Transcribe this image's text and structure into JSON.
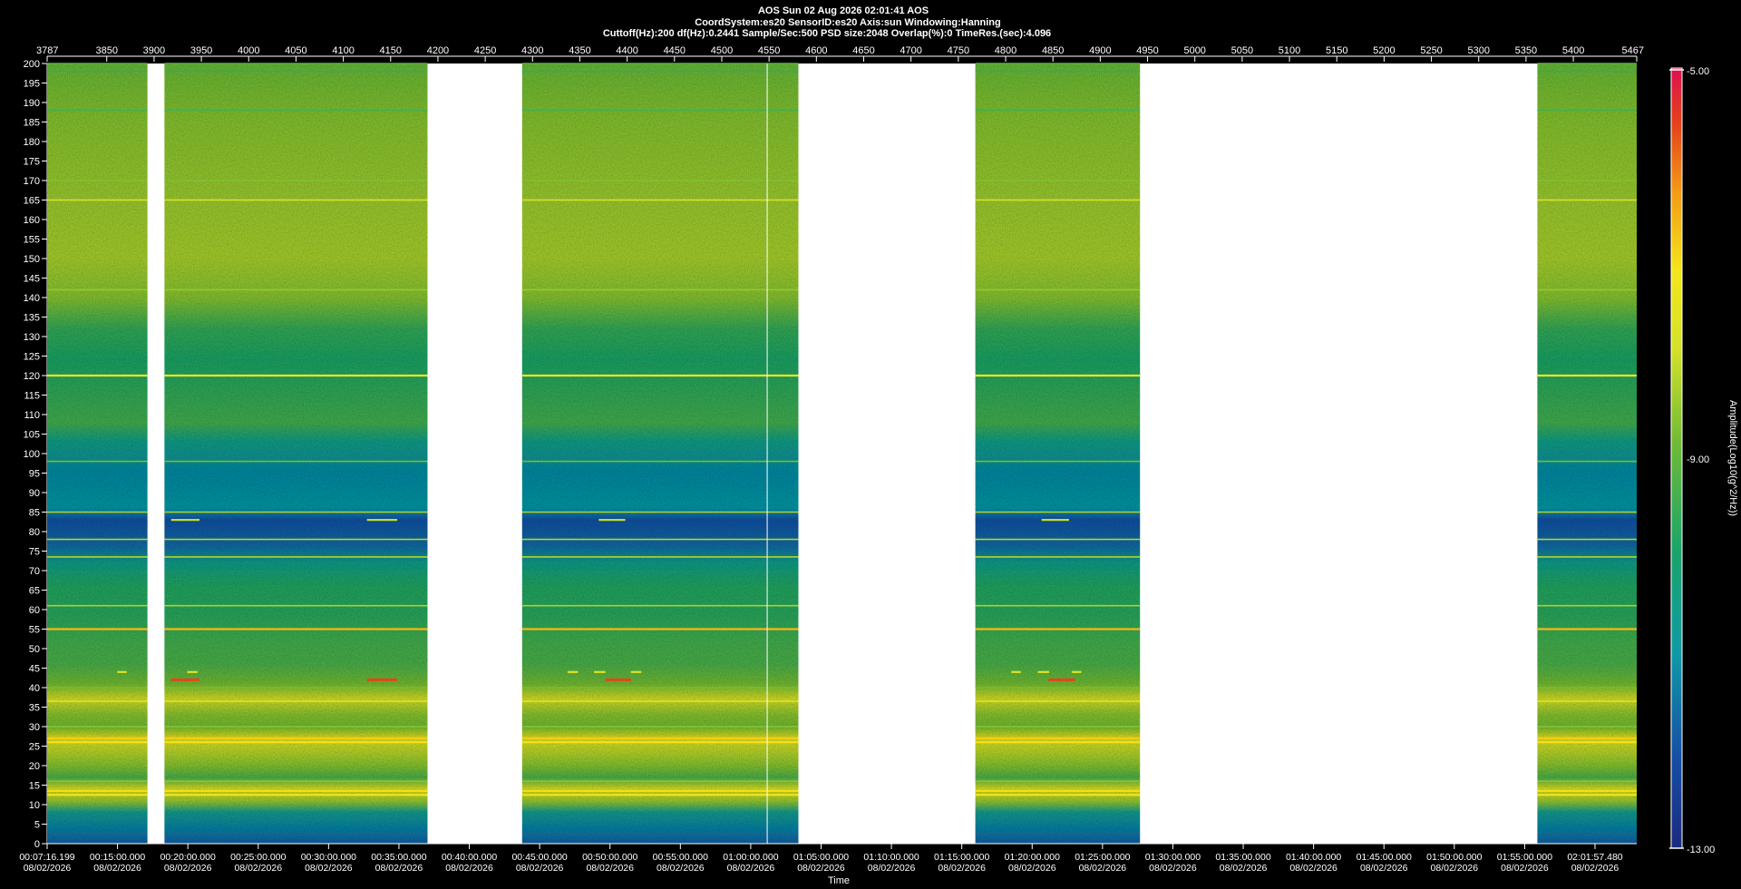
{
  "header": {
    "line1": "AOS  Sun 02 Aug 2026 02:01:41  AOS",
    "line2": "CoordSystem:es20    SensorID:es20    Axis:sun    Windowing:Hanning",
    "line3": "Cuttoff(Hz):200       df(Hz):0.2441       Sample/Sec:500       PSD size:2048       Overlap(%):0         TimeRes.(sec):4.096"
  },
  "chart_data": {
    "type": "heatmap",
    "title": "AOS  Sun 02 Aug 2026 02:01:41  AOS",
    "xlabel": "Time",
    "ylabel": "",
    "colorbar_label": "Amplitude(Log10(g^2/Hz))",
    "colorbar_ticks": [
      "-5.00",
      "-9.00",
      "-13.00"
    ],
    "colorbar_range": [
      -13,
      -5
    ],
    "ylim": [
      0,
      200
    ],
    "y_ticks": [
      0,
      5,
      10,
      15,
      20,
      25,
      30,
      35,
      40,
      45,
      50,
      55,
      60,
      65,
      70,
      75,
      80,
      85,
      90,
      95,
      100,
      105,
      110,
      115,
      120,
      125,
      130,
      135,
      140,
      145,
      150,
      155,
      160,
      165,
      170,
      175,
      180,
      185,
      190,
      195,
      200
    ],
    "top_axis_range": [
      3787,
      5467
    ],
    "top_ticks": [
      3787,
      3850,
      3900,
      3950,
      4000,
      4050,
      4100,
      4150,
      4200,
      4250,
      4300,
      4350,
      4400,
      4450,
      4500,
      4550,
      4600,
      4650,
      4700,
      4750,
      4800,
      4850,
      4900,
      4950,
      5000,
      5050,
      5100,
      5150,
      5200,
      5250,
      5300,
      5350,
      5400,
      5467
    ],
    "time_ticks": [
      {
        "time": "00:07:16.199",
        "date": "08/02/2026"
      },
      {
        "time": "00:15:00.000",
        "date": "08/02/2026"
      },
      {
        "time": "00:20:00.000",
        "date": "08/02/2026"
      },
      {
        "time": "00:25:00.000",
        "date": "08/02/2026"
      },
      {
        "time": "00:30:00.000",
        "date": "08/02/2026"
      },
      {
        "time": "00:35:00.000",
        "date": "08/02/2026"
      },
      {
        "time": "00:40:00.000",
        "date": "08/02/2026"
      },
      {
        "time": "00:45:00.000",
        "date": "08/02/2026"
      },
      {
        "time": "00:50:00.000",
        "date": "08/02/2026"
      },
      {
        "time": "00:55:00.000",
        "date": "08/02/2026"
      },
      {
        "time": "01:00:00.000",
        "date": "08/02/2026"
      },
      {
        "time": "01:05:00.000",
        "date": "08/02/2026"
      },
      {
        "time": "01:10:00.000",
        "date": "08/02/2026"
      },
      {
        "time": "01:15:00.000",
        "date": "08/02/2026"
      },
      {
        "time": "01:20:00.000",
        "date": "08/02/2026"
      },
      {
        "time": "01:25:00.000",
        "date": "08/02/2026"
      },
      {
        "time": "01:30:00.000",
        "date": "08/02/2026"
      },
      {
        "time": "01:35:00.000",
        "date": "08/02/2026"
      },
      {
        "time": "01:40:00.000",
        "date": "08/02/2026"
      },
      {
        "time": "01:45:00.000",
        "date": "08/02/2026"
      },
      {
        "time": "01:50:00.000",
        "date": "08/02/2026"
      },
      {
        "time": "01:55:00.000",
        "date": "08/02/2026"
      },
      {
        "time": "02:01:57.480",
        "date": "08/02/2026"
      }
    ],
    "data_segments": [
      {
        "start": 3787,
        "end": 3893
      },
      {
        "start": 3911,
        "end": 4189
      },
      {
        "start": 4289,
        "end": 4581
      },
      {
        "start": 4768,
        "end": 4942
      },
      {
        "start": 5362,
        "end": 5467
      }
    ],
    "tonal_lines": [
      {
        "hz": 200,
        "level": -9.2
      },
      {
        "hz": 198,
        "level": -9.6
      },
      {
        "hz": 188,
        "level": -9.4
      },
      {
        "hz": 170,
        "level": -8.7
      },
      {
        "hz": 165,
        "level": -7.6
      },
      {
        "hz": 142,
        "level": -8.5
      },
      {
        "hz": 120,
        "level": -7.2
      },
      {
        "hz": 98,
        "level": -8.8
      },
      {
        "hz": 85,
        "level": -8.2
      },
      {
        "hz": 78,
        "level": -8.2
      },
      {
        "hz": 73.5,
        "level": -8.2
      },
      {
        "hz": 61,
        "level": -8.3
      },
      {
        "hz": 55,
        "level": -6.6
      },
      {
        "hz": 40,
        "level": -8.8
      },
      {
        "hz": 36.5,
        "level": -7.6
      },
      {
        "hz": 30,
        "level": -8.6
      },
      {
        "hz": 27,
        "level": -6.8
      },
      {
        "hz": 26,
        "level": -7.2
      },
      {
        "hz": 13.5,
        "level": -7.0
      },
      {
        "hz": 12.5,
        "level": -7.2
      },
      {
        "hz": 16,
        "level": -8.6
      }
    ],
    "tones": [
      {
        "start": 3918,
        "end": 3948,
        "hz": 83,
        "level": -8.0
      },
      {
        "start": 4125,
        "end": 4157,
        "hz": 83,
        "level": -8.0
      },
      {
        "start": 4370,
        "end": 4398,
        "hz": 83,
        "level": -8.0
      },
      {
        "start": 4838,
        "end": 4867,
        "hz": 83,
        "level": -8.0
      },
      {
        "start": 3861,
        "end": 3871,
        "hz": 44,
        "level": -7.6
      },
      {
        "start": 3935,
        "end": 3946,
        "hz": 44,
        "level": -7.6
      },
      {
        "start": 4337,
        "end": 4348,
        "hz": 44,
        "level": -7.6
      },
      {
        "start": 4365,
        "end": 4377,
        "hz": 44,
        "level": -7.6
      },
      {
        "start": 4404,
        "end": 4415,
        "hz": 44,
        "level": -7.6
      },
      {
        "start": 4806,
        "end": 4816,
        "hz": 44,
        "level": -7.6
      },
      {
        "start": 4834,
        "end": 4846,
        "hz": 44,
        "level": -7.6
      },
      {
        "start": 4870,
        "end": 4880,
        "hz": 44,
        "level": -7.6
      },
      {
        "start": 3918,
        "end": 3948,
        "hz": 42,
        "level": -5.6
      },
      {
        "start": 4125,
        "end": 4157,
        "hz": 42,
        "level": -5.6
      },
      {
        "start": 4377,
        "end": 4404,
        "hz": 42,
        "level": -5.6
      },
      {
        "start": 4845,
        "end": 4874,
        "hz": 42,
        "level": -5.6
      }
    ],
    "cursor_x": 4548
  }
}
